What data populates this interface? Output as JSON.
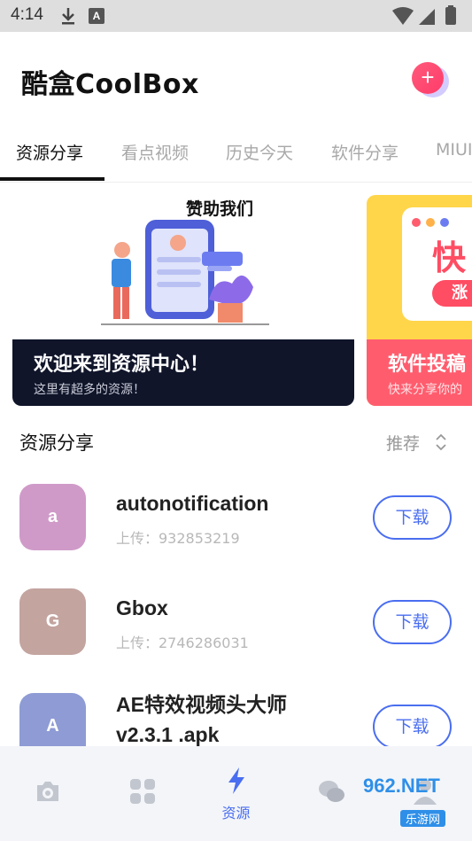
{
  "status_bar": {
    "time": "4:14"
  },
  "header": {
    "title": "酷盒CoolBox",
    "add_symbol": "+"
  },
  "tabs": [
    {
      "label": "资源分享",
      "active": true
    },
    {
      "label": "看点视频",
      "active": false
    },
    {
      "label": "历史今天",
      "active": false
    },
    {
      "label": "软件分享",
      "active": false
    },
    {
      "label": "MIUI",
      "active": false
    }
  ],
  "banners": [
    {
      "art_text": "赞助我们",
      "title": "欢迎来到资源中心！",
      "subtitle": "这里有超多的资源！"
    },
    {
      "art_text": "快",
      "art_pill": "涨",
      "title": "软件投稿",
      "subtitle": "快来分享你的"
    }
  ],
  "section": {
    "title": "资源分享",
    "sort_label": "推荐"
  },
  "items": [
    {
      "initial": "a",
      "name": "autonotification",
      "uploader": "上传：932853219",
      "button": "下载",
      "color": "#cf9ac8"
    },
    {
      "initial": "G",
      "name": "Gbox",
      "uploader": "上传：2746286031",
      "button": "下载",
      "color": "#c3a49f"
    },
    {
      "initial": "A",
      "name": "AE特效视频头大师 v2.3.1 .apk",
      "uploader": "",
      "button": "下载",
      "color": "#8e9bd4"
    }
  ],
  "bottom_nav": [
    {
      "icon": "camera-icon",
      "label": "",
      "active": false
    },
    {
      "icon": "apps-grid-icon",
      "label": "",
      "active": false
    },
    {
      "icon": "lightning-icon",
      "label": "资源",
      "active": true
    },
    {
      "icon": "chat-bubbles-icon",
      "label": "",
      "active": false
    },
    {
      "icon": "user-icon",
      "label": "",
      "active": false
    }
  ],
  "watermark": {
    "text": "962.NET",
    "subtext": "乐游网"
  },
  "colors": {
    "accent": "#4a6ef0",
    "add_button": "#ff4d6d",
    "banner_caption": "#10152a",
    "nav_bg": "#f3f5f9"
  }
}
